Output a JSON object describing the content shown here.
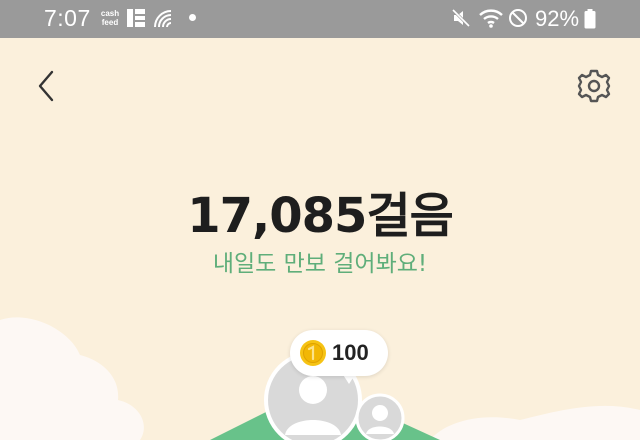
{
  "status_bar": {
    "time": "7:07",
    "cashfeed_line1": "cash",
    "cashfeed_line2": "feed",
    "battery": "92%",
    "icons": [
      "cashfeed-icon",
      "grid-icon",
      "signal-icon",
      "notification-dot-icon",
      "mute-icon",
      "wifi-icon",
      "do-not-disturb-icon",
      "battery-icon"
    ]
  },
  "header": {
    "back_icon": "chevron-left-icon",
    "settings_icon": "gear-icon"
  },
  "steps": {
    "count_text": "17,085걸음",
    "message": "내일도 만보 걸어봐요!"
  },
  "reward": {
    "coin_amount": "100",
    "coin_icon": "coin-icon"
  },
  "colors": {
    "background": "#fbf0dc",
    "accent_green": "#5fae7a",
    "status_bar": "#9a9a9a",
    "coin_gold": "#f2b705"
  }
}
